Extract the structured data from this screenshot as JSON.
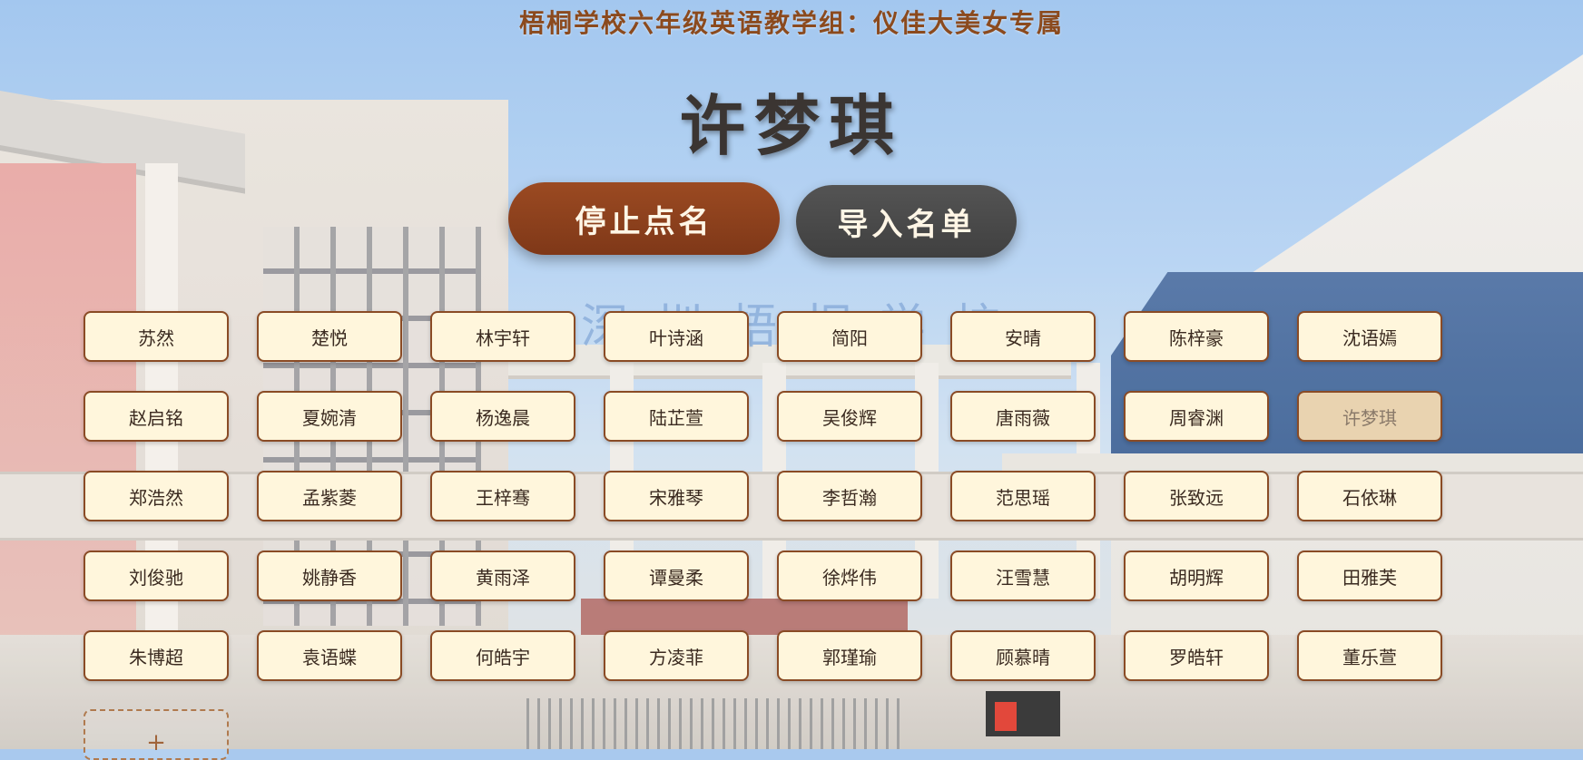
{
  "header": {
    "subtitle": "梧桐学校六年级英语教学组：仪佳大美女专属",
    "current_name": "许梦琪"
  },
  "controls": {
    "stop_label": "停止点名",
    "import_label": "导入名单"
  },
  "background": {
    "sign_text": "深圳梧桐学校"
  },
  "students": [
    [
      "苏然",
      "楚悦",
      "林宇轩",
      "叶诗涵",
      "简阳",
      "安晴",
      "陈梓豪",
      "沈语嫣"
    ],
    [
      "赵启铭",
      "夏婉清",
      "杨逸晨",
      "陆芷萱",
      "吴俊辉",
      "唐雨薇",
      "周睿渊",
      "许梦琪"
    ],
    [
      "郑浩然",
      "孟紫菱",
      "王梓骞",
      "宋雅琴",
      "李哲瀚",
      "范思瑶",
      "张致远",
      "石依琳"
    ],
    [
      "刘俊驰",
      "姚静香",
      "黄雨泽",
      "谭曼柔",
      "徐烨伟",
      "汪雪慧",
      "胡明辉",
      "田雅芙"
    ],
    [
      "朱博超",
      "袁语蝶",
      "何皓宇",
      "方凌菲",
      "郭瑾瑜",
      "顾慕晴",
      "罗皓轩",
      "董乐萱"
    ]
  ],
  "selected": "许梦琪",
  "add_card": {
    "label": "+"
  },
  "colors": {
    "accent": "#8b4a1e",
    "card_bg": "#fff6dc",
    "card_border": "#8a4b25",
    "selected_bg": "#e9d3b0",
    "stop_button": "#8b4220",
    "import_button": "#4a4a4a"
  }
}
